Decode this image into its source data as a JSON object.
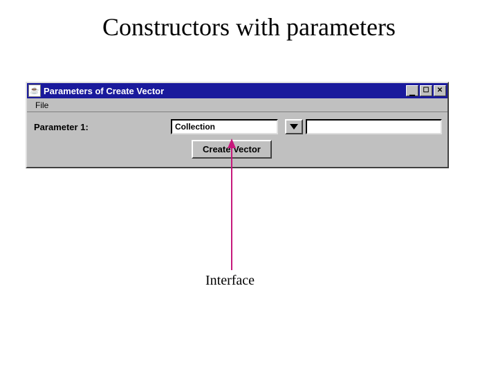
{
  "slide": {
    "title": "Constructors with parameters"
  },
  "window": {
    "title": "Parameters of Create Vector",
    "menu": {
      "file": "File"
    },
    "controls": {
      "min": "_",
      "max": "▭",
      "close": "✕"
    }
  },
  "form": {
    "param1_label": "Parameter 1:",
    "param1_type": "Collection",
    "param1_value": "",
    "submit_label": "Create Vector"
  },
  "annotation": {
    "interface_label": "Interface"
  }
}
